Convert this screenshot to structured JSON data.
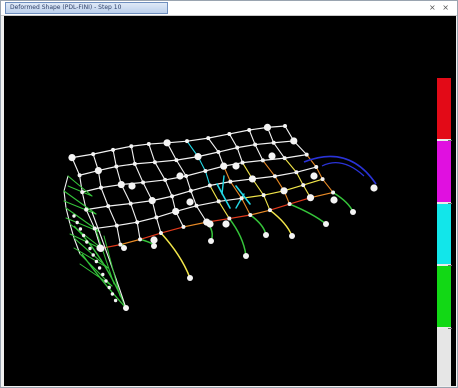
{
  "window": {
    "title_tab": "Deformed Shape (PDL-FINI) - Step 10",
    "controls": [
      "×",
      "×"
    ]
  },
  "viewport": {
    "background": "#000000",
    "model_colors": {
      "grid": "#f2f2f2",
      "nodes": "#f4f4f4",
      "yellow": "#f2e64a",
      "orange": "#e88a26",
      "red": "#e23a1c",
      "green": "#35c43a",
      "cyan": "#23d9e6",
      "blue": "#2a33d8",
      "magenta": "#c43ac4"
    }
  },
  "legend": {
    "colors": [
      "#e30a17",
      "#e010e0",
      "#12e6ea",
      "#12d815",
      "#e6e6e6"
    ]
  }
}
